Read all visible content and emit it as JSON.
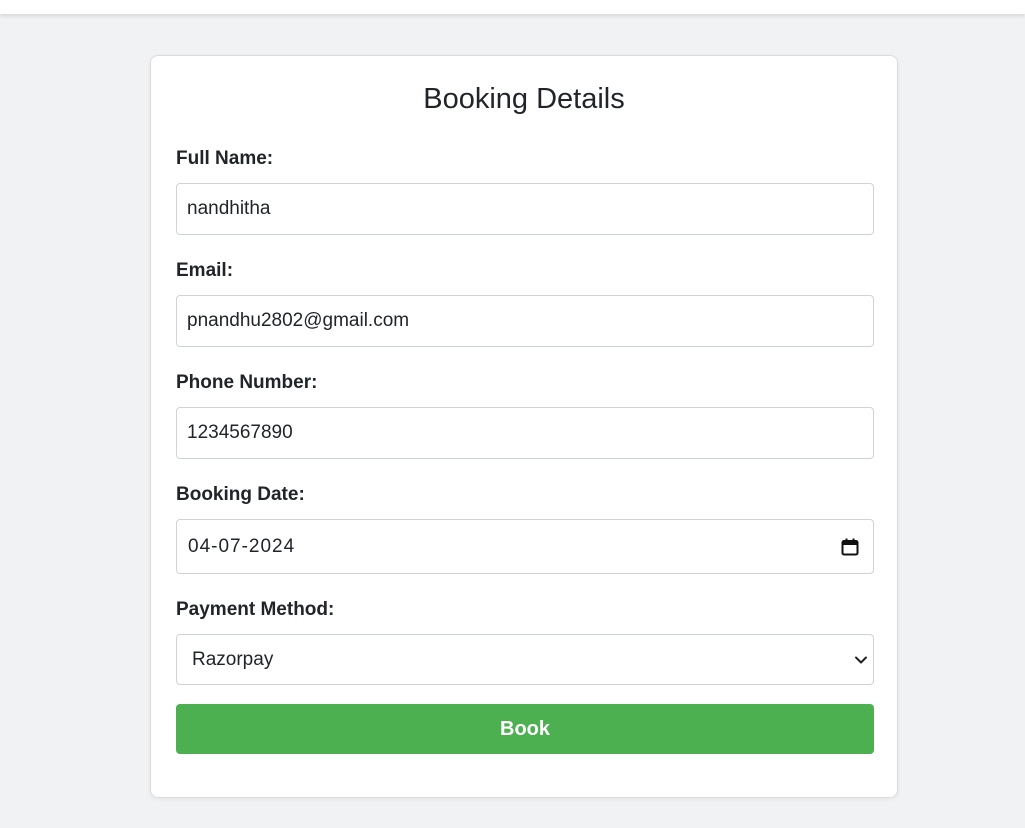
{
  "form": {
    "title": "Booking Details",
    "full_name": {
      "label": "Full Name:",
      "value": "nandhitha"
    },
    "email": {
      "label": "Email:",
      "value": "pnandhu2802@gmail.com"
    },
    "phone": {
      "label": "Phone Number:",
      "value": "1234567890"
    },
    "booking_date": {
      "label": "Booking Date:",
      "value": "04-07-2024",
      "icon": "calendar-icon"
    },
    "payment_method": {
      "label": "Payment Method:",
      "value": "Razorpay",
      "icon": "chevron-down-icon"
    },
    "submit_label": "Book"
  },
  "colors": {
    "page_background": "#f1f2f4",
    "card_background": "#ffffff",
    "button_background": "#4caf50",
    "button_text": "#ffffff",
    "text": "#212529"
  }
}
